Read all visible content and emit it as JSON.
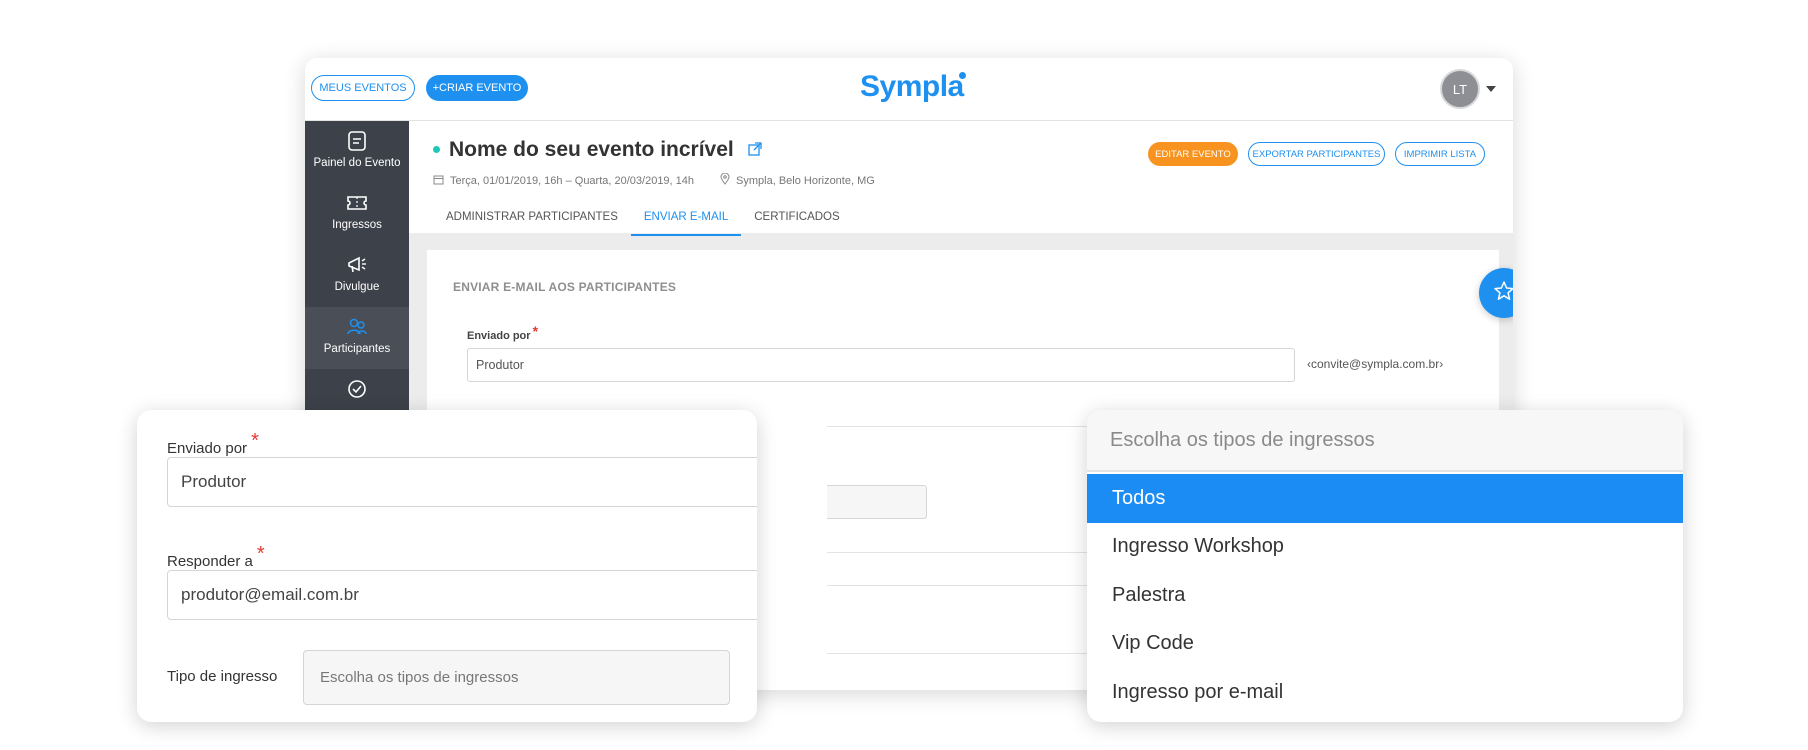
{
  "topbar": {
    "my_events": "MEUS EVENTOS",
    "create_event": "+CRIAR EVENTO",
    "logo": "Sympla",
    "avatar_initials": "LT"
  },
  "sidebar": {
    "items": [
      {
        "label": "Painel do Evento",
        "icon": "dashboard-icon"
      },
      {
        "label": "Ingressos",
        "icon": "ticket-icon"
      },
      {
        "label": "Divulgue",
        "icon": "megaphone-icon"
      },
      {
        "label": "Participantes",
        "icon": "participants-icon"
      },
      {
        "label": "",
        "icon": "check-circle-icon"
      }
    ]
  },
  "event": {
    "title": "Nome do seu evento incrível",
    "date": "Terça, 01/01/2019, 16h – Quarta, 20/03/2019, 14h",
    "location": "Sympla, Belo Horizonte, MG"
  },
  "actions": {
    "edit": "EDITAR EVENTO",
    "export": "EXPORTAR PARTICIPANTES",
    "print": "IMPRIMIR LISTA"
  },
  "tabs": [
    "ADMINISTRAR PARTICIPANTES",
    "ENVIAR E-MAIL",
    "CERTIFICADOS"
  ],
  "email_form": {
    "heading": "ENVIAR E-MAIL AOS PARTICIPANTES",
    "sent_by_label": "Enviado por",
    "sent_by_value": "Produtor",
    "sender_email": "‹convite@sympla.com.br›"
  },
  "zoom_form": {
    "sent_by_label": "Enviado por",
    "sent_by_value": "Produtor",
    "reply_to_label": "Responder a",
    "reply_to_value": "produtor@email.com.br",
    "ticket_type_label": "Tipo de ingresso",
    "ticket_type_placeholder": "Escolha os tipos de ingressos"
  },
  "dropdown": {
    "placeholder": "Escolha os tipos de ingressos",
    "options": [
      "Todos",
      "Ingresso Workshop",
      "Palestra",
      "Vip Code",
      "Ingresso por e-mail"
    ],
    "selected": "Todos"
  },
  "colors": {
    "brand": "#1e90f0",
    "orange": "#f7931e",
    "sidebar": "#3d4149",
    "required": "#e53935"
  }
}
